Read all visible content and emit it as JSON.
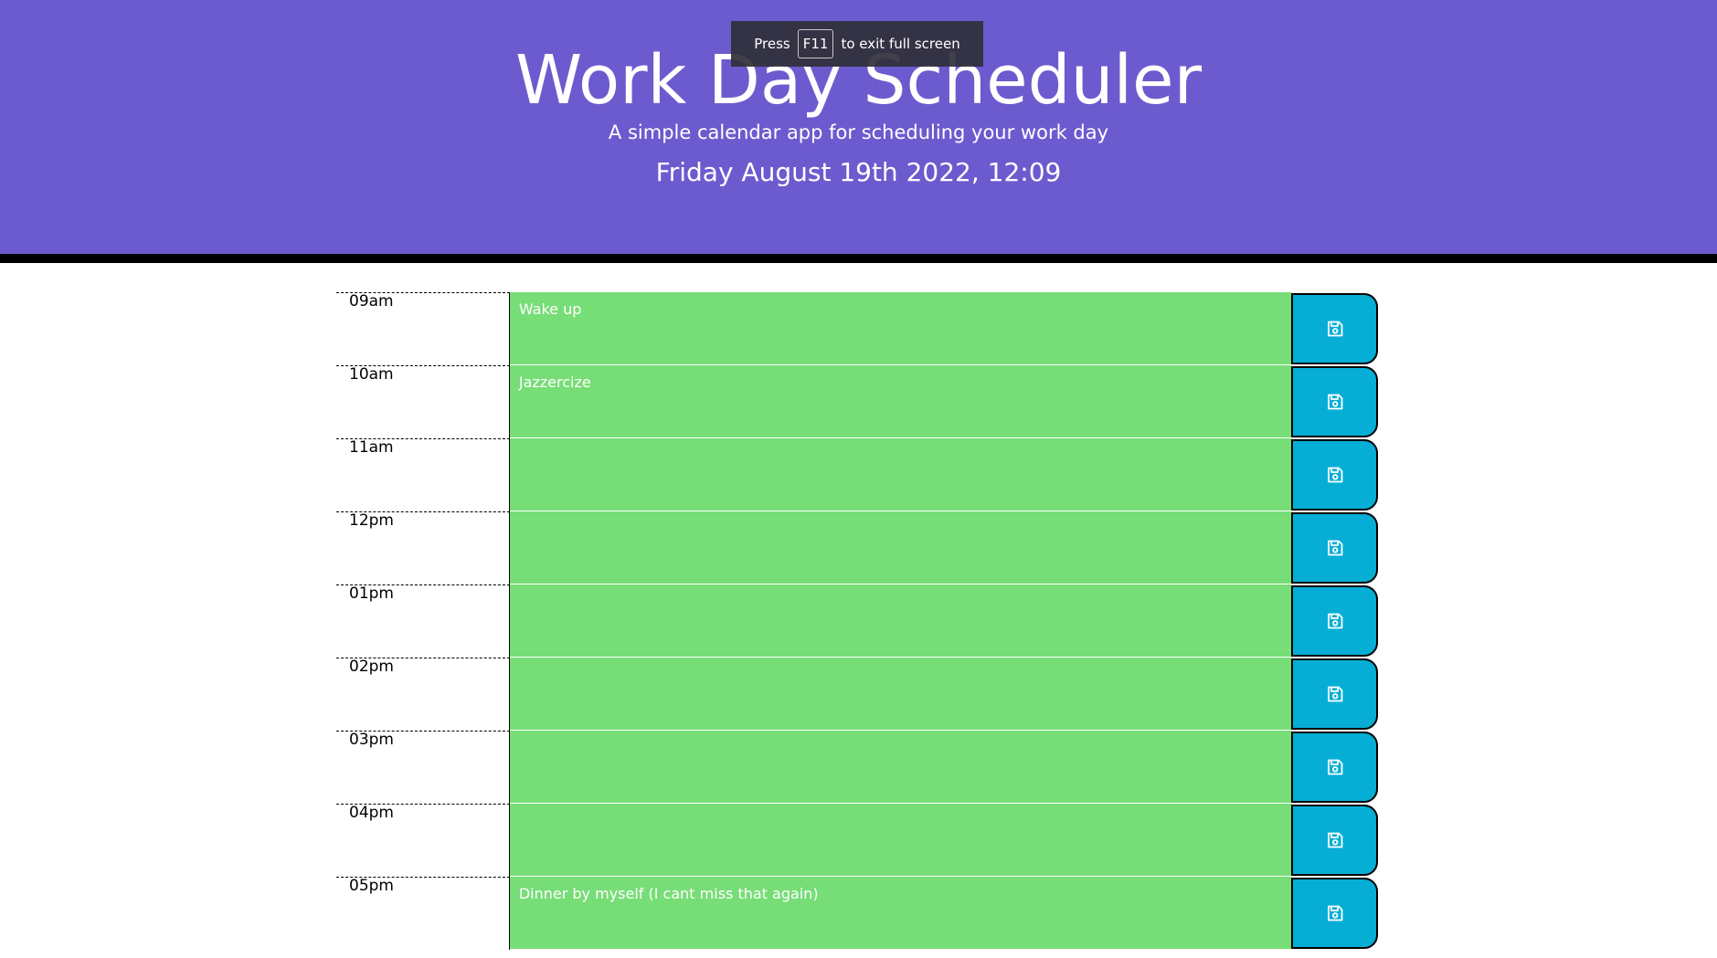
{
  "header": {
    "title": "Work Day Scheduler",
    "lead": "A simple calendar app for scheduling your work day",
    "current_day": "Friday August 19th 2022, 12:09"
  },
  "fullscreen_toast": {
    "press": "Press",
    "key": "F11",
    "suffix": "to exit full screen"
  },
  "colors": {
    "header_bg": "#6c5bce",
    "future": "#77dd77",
    "save_button": "#06aed5"
  },
  "time_blocks": [
    {
      "hour": "09am",
      "text": "Wake up",
      "icon": "floppy-disk-icon"
    },
    {
      "hour": "10am",
      "text": "Jazzercize",
      "icon": "floppy-disk-icon"
    },
    {
      "hour": "11am",
      "text": "",
      "icon": "floppy-disk-icon"
    },
    {
      "hour": "12pm",
      "text": "",
      "icon": "floppy-disk-icon"
    },
    {
      "hour": "01pm",
      "text": "",
      "icon": "floppy-disk-icon"
    },
    {
      "hour": "02pm",
      "text": "",
      "icon": "floppy-disk-icon"
    },
    {
      "hour": "03pm",
      "text": "",
      "icon": "floppy-disk-icon"
    },
    {
      "hour": "04pm",
      "text": "",
      "icon": "floppy-disk-icon"
    },
    {
      "hour": "05pm",
      "text": "Dinner by myself (I cant miss that again)",
      "icon": "floppy-disk-icon"
    }
  ]
}
